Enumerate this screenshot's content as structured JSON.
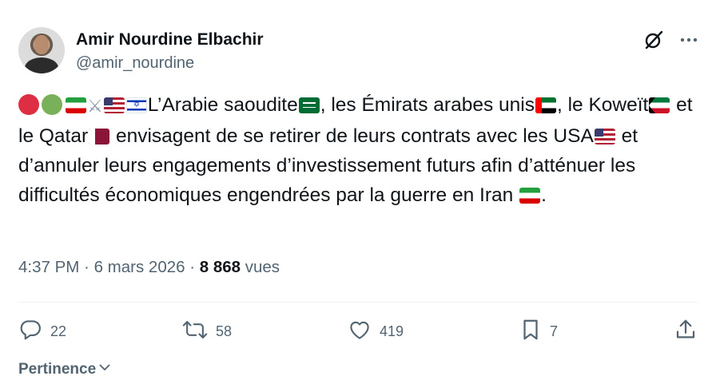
{
  "author": {
    "name": "Amir Nourdine Elbachir",
    "handle": "@amir_nourdine"
  },
  "tweet": {
    "seg1": "L’Arabie saoudite",
    "seg2": ", les Émirats arabes unis",
    "seg3": ", le Koweït",
    "seg4": " et le Qatar",
    "seg5": " envisagent de se retirer de leurs contrats avec les USA",
    "seg6": " et d’annuler leurs engagements d’investissement futurs afin d’atténuer les difficultés économiques engendrées par la guerre en Iran ",
    "seg7": "."
  },
  "meta": {
    "time": "4:37 PM",
    "sep1": " · ",
    "date": "6 mars 2026",
    "sep2": " · ",
    "views_count": "8 868",
    "views_label": " vues"
  },
  "actions": {
    "replies": "22",
    "reposts": "58",
    "likes": "419",
    "bookmarks": "7"
  },
  "sort": {
    "label": "Pertinence"
  },
  "icons": {
    "grok": "grok-icon",
    "more": "more-icon",
    "reply": "reply-icon",
    "repost": "repost-icon",
    "like": "heart-icon",
    "bookmark": "bookmark-icon",
    "share": "share-icon",
    "chevron": "chevron-down-icon"
  },
  "colors": {
    "text": "#0f1419",
    "secondary": "#536471",
    "divider": "#eff3f4"
  }
}
